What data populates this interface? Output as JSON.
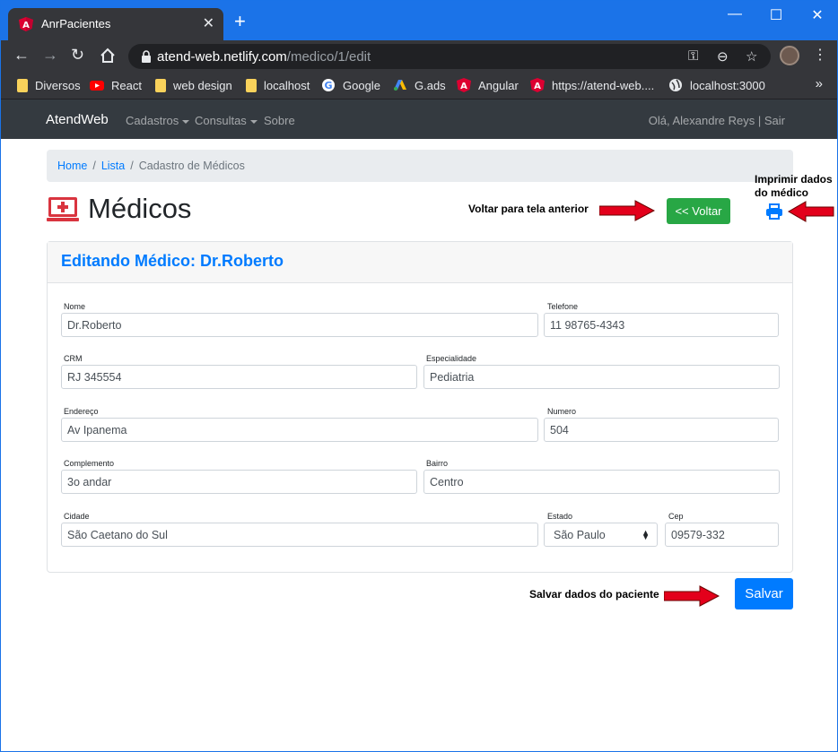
{
  "browser": {
    "tab_title": "AnrPacientes",
    "url_host": "atend-web.netlify.com",
    "url_path": "/medico/1/edit",
    "bookmarks": [
      {
        "label": "Diversos",
        "icon": "folder-icon"
      },
      {
        "label": "React",
        "icon": "youtube-icon"
      },
      {
        "label": "web design",
        "icon": "folder-icon"
      },
      {
        "label": "localhost",
        "icon": "folder-icon"
      },
      {
        "label": "Google",
        "icon": "google-icon"
      },
      {
        "label": "G.ads",
        "icon": "google-ads-icon"
      },
      {
        "label": "Angular",
        "icon": "angular-icon"
      },
      {
        "label": "https://atend-web....",
        "icon": "angular-icon"
      },
      {
        "label": "localhost:3000",
        "icon": "globe-icon"
      }
    ]
  },
  "navbar": {
    "brand": "AtendWeb",
    "links": [
      "Cadastros",
      "Consultas",
      "Sobre"
    ],
    "greeting": "Olá, Alexandre Reys | Sair"
  },
  "breadcrumb": {
    "home": "Home",
    "list": "Lista",
    "current": "Cadastro de Médicos"
  },
  "header": {
    "title": "Médicos",
    "back_button": "<< Voltar",
    "note_back": "Voltar para tela anterior",
    "note_print_line1": "Imprimir dados",
    "note_print_line2": "do médico",
    "note_save": "Salvar dados do paciente"
  },
  "form": {
    "card_title": "Editando Médico: Dr.Roberto",
    "fields": {
      "nome": {
        "label": "Nome",
        "value": "Dr.Roberto"
      },
      "telefone": {
        "label": "Telefone",
        "value": "11 98765-4343"
      },
      "crm": {
        "label": "CRM",
        "value": "RJ 345554"
      },
      "especialidade": {
        "label": "Especialidade",
        "value": "Pediatria"
      },
      "endereco": {
        "label": "Endereço",
        "value": "Av Ipanema"
      },
      "numero": {
        "label": "Numero",
        "value": "504"
      },
      "complemento": {
        "label": "Complemento",
        "value": "3o andar"
      },
      "bairro": {
        "label": "Bairro",
        "value": "Centro"
      },
      "cidade": {
        "label": "Cidade",
        "value": "São Caetano do Sul"
      },
      "estado": {
        "label": "Estado",
        "value": "São Paulo"
      },
      "cep": {
        "label": "Cep",
        "value": "09579-332"
      }
    },
    "save_button": "Salvar"
  },
  "colors": {
    "primary": "#007bff",
    "success": "#28a745",
    "navbar": "#343a40",
    "annotation_arrow": "#e3001b",
    "page_icon": "#d9343f"
  }
}
